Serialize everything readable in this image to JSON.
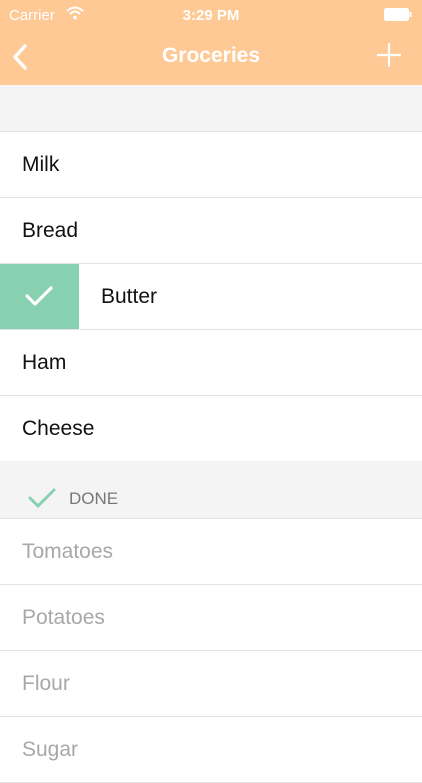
{
  "status": {
    "carrier": "Carrier",
    "time": "3:29 PM"
  },
  "nav": {
    "title": "Groceries",
    "back_icon": "chevron-left",
    "add_icon": "plus"
  },
  "colors": {
    "header": "#ffc995",
    "swipe": "#87d0b0",
    "done_check": "#87d0b0"
  },
  "todo": [
    {
      "label": "Milk"
    },
    {
      "label": "Bread"
    },
    {
      "label": "Butter",
      "swiped": true
    },
    {
      "label": "Ham"
    },
    {
      "label": "Cheese"
    }
  ],
  "done": {
    "header": "DONE",
    "items": [
      {
        "label": "Tomatoes"
      },
      {
        "label": "Potatoes"
      },
      {
        "label": "Flour"
      },
      {
        "label": "Sugar"
      }
    ]
  }
}
